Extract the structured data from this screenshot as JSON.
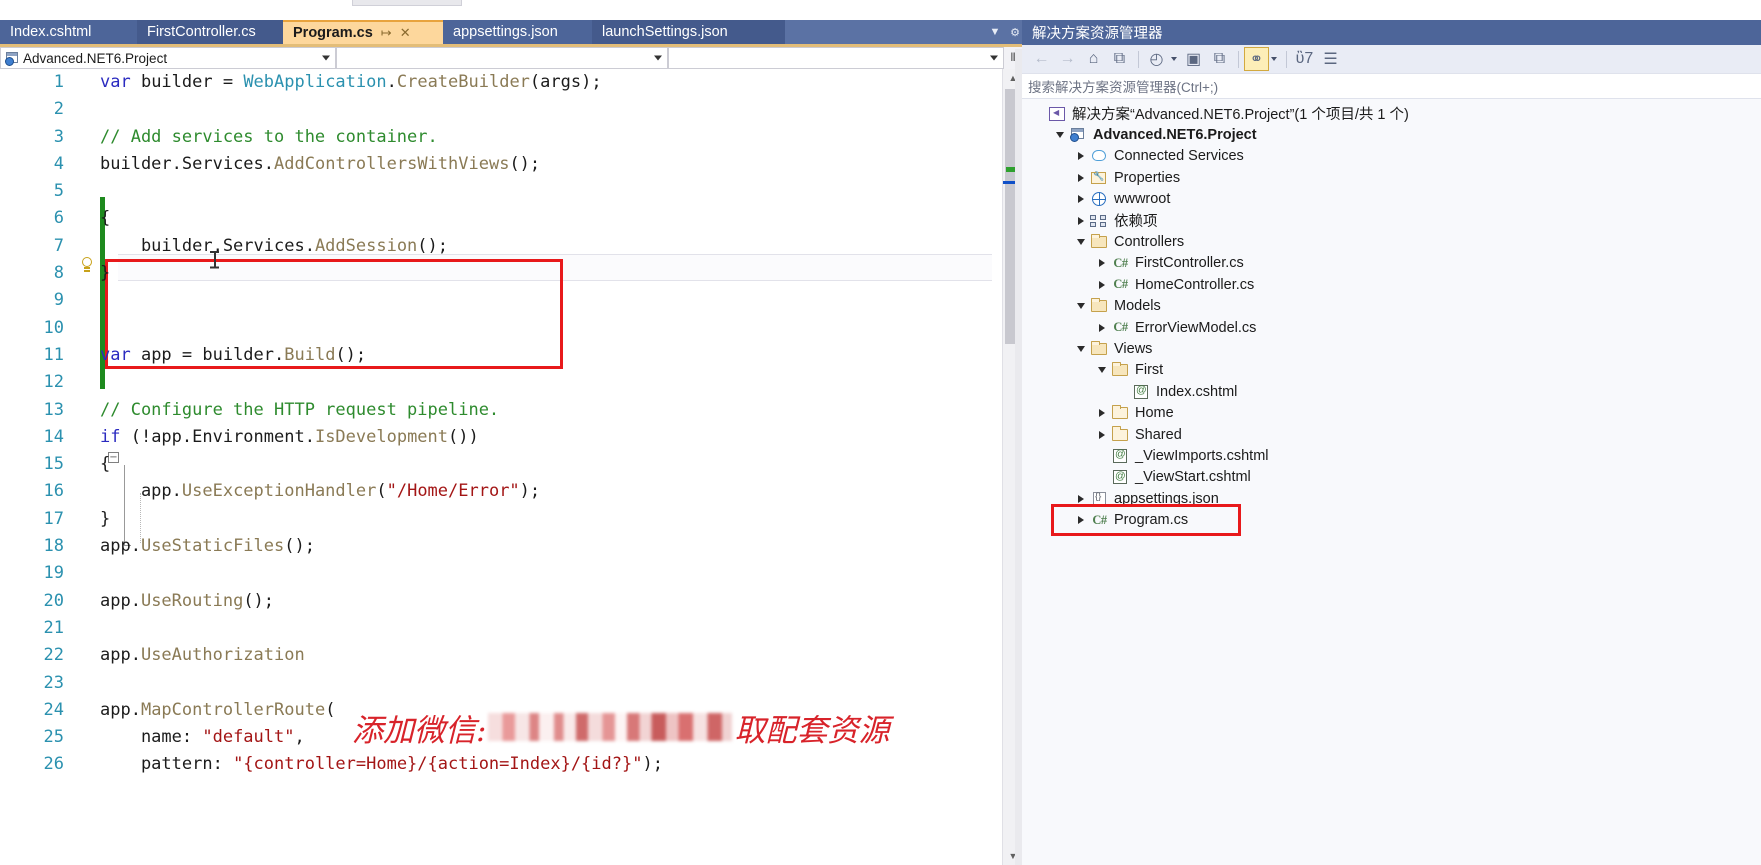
{
  "window": {
    "editor_tabs": [
      {
        "label": "Index.cshtml",
        "active": false
      },
      {
        "label": "FirstController.cs",
        "active": false
      },
      {
        "label": "Program.cs",
        "active": true,
        "pin": "↦",
        "close": "✕"
      },
      {
        "label": "appsettings.json",
        "active": false
      },
      {
        "label": "launchSettings.json",
        "active": false
      }
    ],
    "tab_overflow_icon": "chevron-down",
    "tab_settings_icon": "gear"
  },
  "navbar": {
    "project_value": "Advanced.NET6.Project",
    "type_value": "",
    "member_value": "",
    "splitter_glyph": "⫴"
  },
  "code": {
    "lines": [
      {
        "n": "1",
        "tokens": [
          {
            "t": "var ",
            "c": "kw"
          },
          {
            "t": "builder = ",
            "c": "pln"
          },
          {
            "t": "WebApplication",
            "c": "typ"
          },
          {
            "t": ".",
            "c": "pln"
          },
          {
            "t": "CreateBuilder",
            "c": "mth"
          },
          {
            "t": "(args);",
            "c": "pln"
          }
        ]
      },
      {
        "n": "2",
        "tokens": []
      },
      {
        "n": "3",
        "tokens": [
          {
            "t": "// Add services to the container.",
            "c": "com"
          }
        ]
      },
      {
        "n": "4",
        "tokens": [
          {
            "t": "builder.",
            "c": "pln"
          },
          {
            "t": "Services",
            "c": "pln"
          },
          {
            "t": ".",
            "c": "pln"
          },
          {
            "t": "AddControllersWithViews",
            "c": "mth"
          },
          {
            "t": "();",
            "c": "pln"
          }
        ]
      },
      {
        "n": "5",
        "tokens": []
      },
      {
        "n": "6",
        "tokens": [
          {
            "t": "{",
            "c": "pln"
          }
        ]
      },
      {
        "n": "7",
        "tokens": [
          {
            "t": "    builder.Services.",
            "c": "pln"
          },
          {
            "t": "AddSession",
            "c": "mth"
          },
          {
            "t": "();",
            "c": "pln"
          }
        ]
      },
      {
        "n": "8",
        "tokens": [
          {
            "t": "}",
            "c": "pln"
          }
        ]
      },
      {
        "n": "9",
        "tokens": []
      },
      {
        "n": "10",
        "tokens": []
      },
      {
        "n": "11",
        "tokens": [
          {
            "t": "var ",
            "c": "kw"
          },
          {
            "t": "app = builder.",
            "c": "pln"
          },
          {
            "t": "Build",
            "c": "mth"
          },
          {
            "t": "();",
            "c": "pln"
          }
        ]
      },
      {
        "n": "12",
        "tokens": []
      },
      {
        "n": "13",
        "tokens": [
          {
            "t": "// Configure the HTTP request pipeline.",
            "c": "com"
          }
        ]
      },
      {
        "n": "14",
        "tokens": [
          {
            "t": "if ",
            "c": "kw"
          },
          {
            "t": "(!app.Environment.",
            "c": "pln"
          },
          {
            "t": "IsDevelopment",
            "c": "mth"
          },
          {
            "t": "())",
            "c": "pln"
          }
        ]
      },
      {
        "n": "15",
        "tokens": [
          {
            "t": "{",
            "c": "pln"
          }
        ]
      },
      {
        "n": "16",
        "tokens": [
          {
            "t": "    app.",
            "c": "pln"
          },
          {
            "t": "UseExceptionHandler",
            "c": "mth"
          },
          {
            "t": "(",
            "c": "pln"
          },
          {
            "t": "\"/Home/Error\"",
            "c": "str"
          },
          {
            "t": ");",
            "c": "pln"
          }
        ]
      },
      {
        "n": "17",
        "tokens": [
          {
            "t": "}",
            "c": "pln"
          }
        ]
      },
      {
        "n": "18",
        "tokens": [
          {
            "t": "app.",
            "c": "pln"
          },
          {
            "t": "UseStaticFiles",
            "c": "mth"
          },
          {
            "t": "();",
            "c": "pln"
          }
        ]
      },
      {
        "n": "19",
        "tokens": []
      },
      {
        "n": "20",
        "tokens": [
          {
            "t": "app.",
            "c": "pln"
          },
          {
            "t": "UseRouting",
            "c": "mth"
          },
          {
            "t": "();",
            "c": "pln"
          }
        ]
      },
      {
        "n": "21",
        "tokens": []
      },
      {
        "n": "22",
        "tokens": [
          {
            "t": "app.",
            "c": "pln"
          },
          {
            "t": "UseAuthorization",
            "c": "mth"
          },
          {
            "t": "",
            "c": "pln"
          }
        ]
      },
      {
        "n": "23",
        "tokens": []
      },
      {
        "n": "24",
        "tokens": [
          {
            "t": "app.",
            "c": "pln"
          },
          {
            "t": "MapControllerRoute",
            "c": "mth"
          },
          {
            "t": "(",
            "c": "pln"
          }
        ]
      },
      {
        "n": "25",
        "tokens": [
          {
            "t": "    name: ",
            "c": "pln"
          },
          {
            "t": "\"default\"",
            "c": "str"
          },
          {
            "t": ",",
            "c": "pln"
          }
        ]
      },
      {
        "n": "26",
        "tokens": [
          {
            "t": "    pattern: ",
            "c": "pln"
          },
          {
            "t": "\"{controller=Home}/{action=Index}/{id?}\"",
            "c": "str"
          },
          {
            "t": ");",
            "c": "pln"
          }
        ]
      }
    ],
    "watermark_prefix": "添加微信:",
    "watermark_suffix": "取配套资源",
    "annotation_color": "#e8191b"
  },
  "solution_explorer": {
    "title": "解决方案资源管理器",
    "search_placeholder": "搜索解决方案资源管理器(Ctrl+;)",
    "toolbar": [
      {
        "name": "back-icon",
        "glyph": "←",
        "state": "disabled"
      },
      {
        "name": "forward-icon",
        "glyph": "→",
        "state": "disabled"
      },
      {
        "name": "home-icon",
        "glyph": "⌂",
        "state": "normal"
      },
      {
        "name": "sync-with-active-document-icon",
        "glyph": "⧉",
        "state": "normal"
      },
      {
        "name": "pending-changes-filter-icon",
        "glyph": "◴",
        "state": "normal",
        "caret": true
      },
      {
        "name": "show-all-files-icon",
        "glyph": "▣",
        "state": "normal"
      },
      {
        "name": "refresh-icon",
        "glyph": "⧉",
        "state": "normal"
      },
      {
        "name": "view-class-diagram-icon",
        "glyph": "⚭",
        "state": "selected",
        "caret": true
      },
      {
        "name": "properties-icon",
        "glyph": "ὒ7",
        "state": "normal"
      },
      {
        "name": "preview-selected-items-icon",
        "glyph": "☰",
        "state": "normal"
      }
    ],
    "tree": [
      {
        "label": "解决方案“Advanced.NET6.Project”(1 个项目/共 1 个)",
        "indent": 0,
        "twisty": "none",
        "icon": "solution-icon",
        "bold": false
      },
      {
        "label": "Advanced.NET6.Project",
        "indent": 1,
        "twisty": "down",
        "icon": "project-icon",
        "bold": true
      },
      {
        "label": "Connected Services",
        "indent": 2,
        "twisty": "right",
        "icon": "connected-services-icon",
        "bold": false
      },
      {
        "label": "Properties",
        "indent": 2,
        "twisty": "right",
        "icon": "properties-folder-icon",
        "bold": false
      },
      {
        "label": "wwwroot",
        "indent": 2,
        "twisty": "right",
        "icon": "globe-icon",
        "bold": false
      },
      {
        "label": "依赖项",
        "indent": 2,
        "twisty": "right",
        "icon": "dependencies-icon",
        "bold": false
      },
      {
        "label": "Controllers",
        "indent": 2,
        "twisty": "down",
        "icon": "folder-open-icon",
        "bold": false
      },
      {
        "label": "FirstController.cs",
        "indent": 3,
        "twisty": "right",
        "icon": "csharp-file-icon",
        "bold": false
      },
      {
        "label": "HomeController.cs",
        "indent": 3,
        "twisty": "right",
        "icon": "csharp-file-icon",
        "bold": false
      },
      {
        "label": "Models",
        "indent": 2,
        "twisty": "down",
        "icon": "folder-open-icon",
        "bold": false
      },
      {
        "label": "ErrorViewModel.cs",
        "indent": 3,
        "twisty": "right",
        "icon": "csharp-file-icon",
        "bold": false
      },
      {
        "label": "Views",
        "indent": 2,
        "twisty": "down",
        "icon": "folder-open-icon",
        "bold": false
      },
      {
        "label": "First",
        "indent": 3,
        "twisty": "down",
        "icon": "folder-open-icon",
        "bold": false
      },
      {
        "label": "Index.cshtml",
        "indent": 4,
        "twisty": "none",
        "icon": "razor-file-icon",
        "bold": false
      },
      {
        "label": "Home",
        "indent": 3,
        "twisty": "right",
        "icon": "folder-icon",
        "bold": false
      },
      {
        "label": "Shared",
        "indent": 3,
        "twisty": "right",
        "icon": "folder-icon",
        "bold": false
      },
      {
        "label": "_ViewImports.cshtml",
        "indent": 3,
        "twisty": "none",
        "icon": "razor-file-icon",
        "bold": false
      },
      {
        "label": "_ViewStart.cshtml",
        "indent": 3,
        "twisty": "none",
        "icon": "razor-file-icon",
        "bold": false
      },
      {
        "label": "appsettings.json",
        "indent": 2,
        "twisty": "right",
        "icon": "json-file-icon",
        "bold": false
      },
      {
        "label": "Program.cs",
        "indent": 2,
        "twisty": "right",
        "icon": "csharp-file-icon",
        "bold": false,
        "highlighted": true
      }
    ]
  }
}
